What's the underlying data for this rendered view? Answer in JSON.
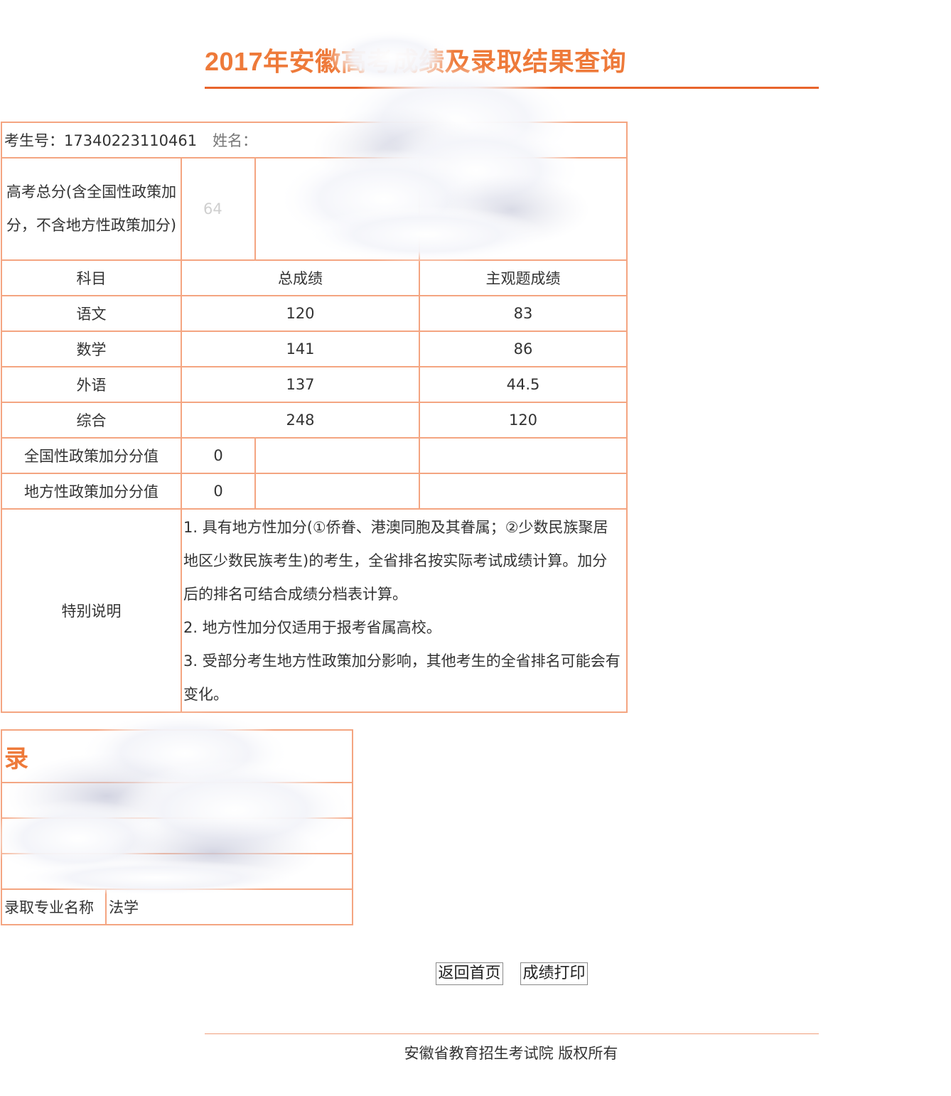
{
  "header": {
    "title": "2017年安徽高考成绩及录取结果查询"
  },
  "candidate": {
    "exam_no_label": "考生号：",
    "exam_no": "17340223110461",
    "name_label": "姓名："
  },
  "score": {
    "total_label": "高考总分(含全国性政策加分，不含地方性政策加分)",
    "total_value": "64",
    "headers": {
      "subject": "科目",
      "total": "总成绩",
      "subjective": "主观题成绩"
    },
    "subjects": [
      {
        "name": "语文",
        "total": "120",
        "subjective": "83"
      },
      {
        "name": "数学",
        "total": "141",
        "subjective": "86"
      },
      {
        "name": "外语",
        "total": "137",
        "subjective": "44.5"
      },
      {
        "name": "综合",
        "total": "248",
        "subjective": "120"
      }
    ],
    "national_bonus_label": "全国性政策加分分值",
    "national_bonus_value": "0",
    "local_bonus_label": "地方性政策加分分值",
    "local_bonus_value": "0",
    "notes_label": "特别说明",
    "notes": [
      "1. 具有地方性加分(①侨眷、港澳同胞及其眷属；②少数民族聚居地区少数民族考生)的考生，全省排名按实际考试成绩计算。加分后的排名可结合成绩分档表计算。",
      "2. 地方性加分仅适用于报考省属高校。",
      "3. 受部分考生地方性政策加分影响，其他考生的全省排名可能会有变化。"
    ]
  },
  "admission": {
    "heading_partial": "录",
    "major_label": "录取专业名称",
    "major_value": "法学"
  },
  "buttons": {
    "home": "返回首页",
    "print": "成绩打印"
  },
  "footer": {
    "copyright": "安徽省教育招生考试院 版权所有"
  },
  "colors": {
    "accent": "#ee7a3a",
    "rule": "#e8642c",
    "border": "#f4a581"
  }
}
